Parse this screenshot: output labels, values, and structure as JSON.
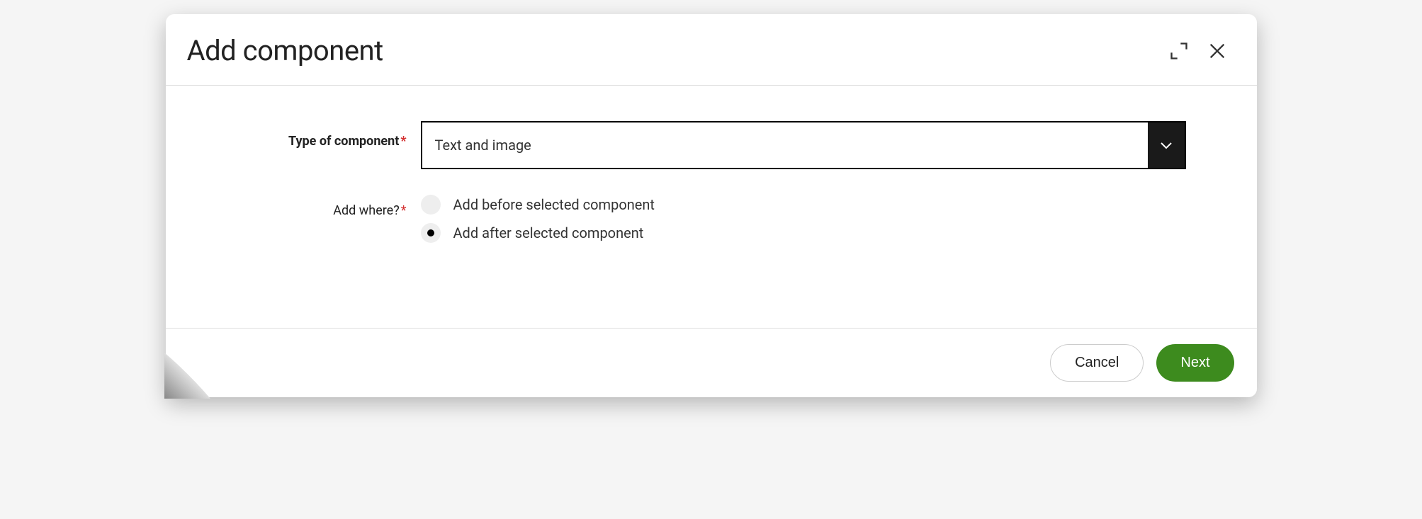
{
  "dialog": {
    "title": "Add component"
  },
  "form": {
    "typeLabel": "Type of component",
    "typeValue": "Text and image",
    "addWhereLabel": "Add where?",
    "radioOptions": [
      {
        "label": "Add before selected component",
        "selected": false
      },
      {
        "label": "Add after selected component",
        "selected": true
      }
    ]
  },
  "footer": {
    "cancel": "Cancel",
    "next": "Next"
  }
}
